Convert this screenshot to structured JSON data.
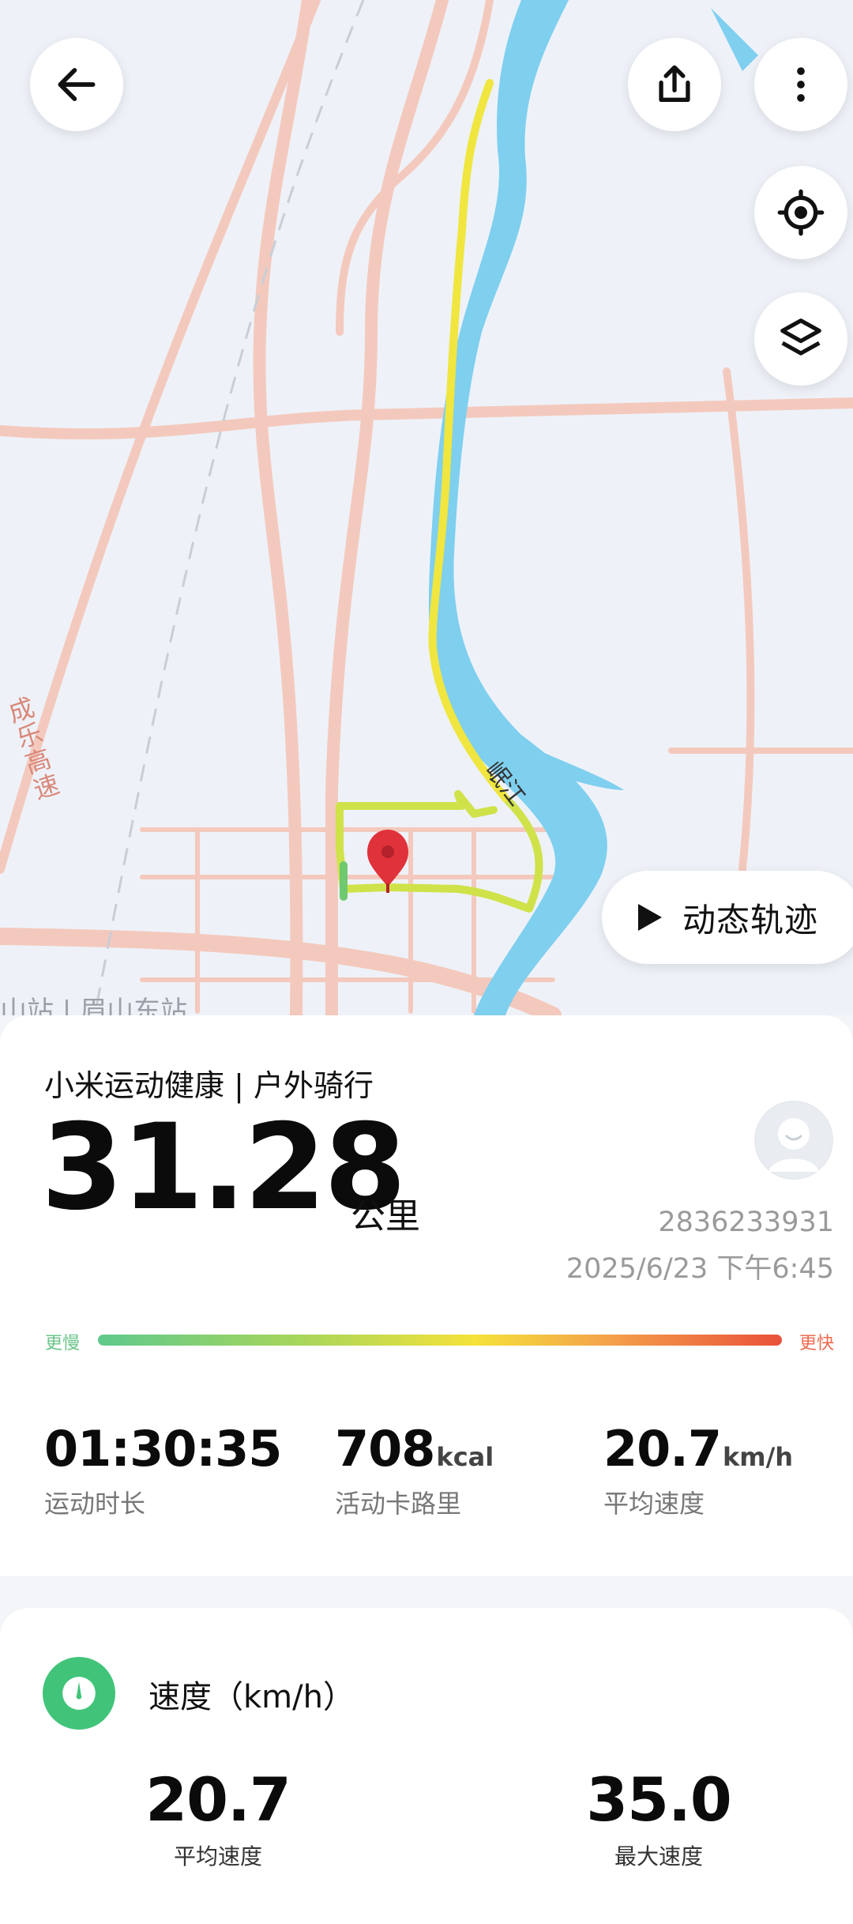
{
  "map": {
    "station_label": "山站 | 眉山东站",
    "river_label": "岷江",
    "road_label": "成乐高速",
    "dynamic_track_label": "动态轨迹",
    "buttons": {
      "back_icon": "arrow-left-icon",
      "share_icon": "share-icon",
      "more_icon": "more-vertical-icon",
      "locate_icon": "locate-icon",
      "layers_icon": "layers-icon"
    },
    "colors": {
      "river": "#7fcfef",
      "road": "#f4c3b6",
      "track_slow": "#8fd24d",
      "track_fast": "#f2e53c",
      "pin": "#e0323a"
    }
  },
  "summary": {
    "source": "小米运动健康 | 户外骑行",
    "distance": "31.28",
    "distance_unit": "公里",
    "user_id": "2836233931",
    "datetime": "2025/6/23 下午6:45",
    "slower_label": "更慢",
    "faster_label": "更快",
    "stats": [
      {
        "value": "01:30:35",
        "unit": "",
        "label": "运动时长"
      },
      {
        "value": "708",
        "unit": "kcal",
        "label": "活动卡路里"
      },
      {
        "value": "20.7",
        "unit": "km/h",
        "label": "平均速度"
      }
    ]
  },
  "speed": {
    "title": "速度（km/h）",
    "avg_value": "20.7",
    "avg_label": "平均速度",
    "max_value": "35.0",
    "max_label": "最大速度"
  }
}
